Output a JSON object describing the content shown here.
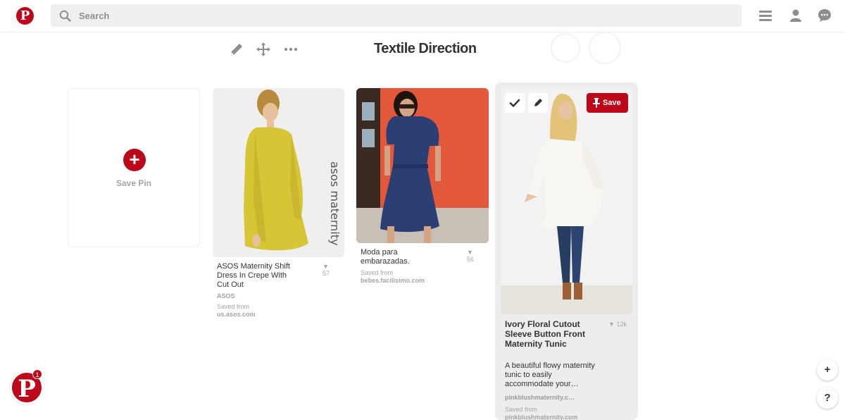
{
  "header": {
    "logo_glyph": "P",
    "search_placeholder": "Search",
    "icons": [
      "menu-icon",
      "profile-icon",
      "messages-icon"
    ]
  },
  "board": {
    "title": "Textile Direction",
    "tools": [
      "edit-pencil-icon",
      "move-arrows-icon",
      "more-dots-icon"
    ]
  },
  "save_pin": {
    "label": "Save Pin",
    "icon": "plus-icon"
  },
  "pins": [
    {
      "description": "ASOS Maternity Shift Dress In Crepe With Cut Out",
      "repins": "57",
      "source_name": "ASOS",
      "saved_from_label": "Saved from",
      "saved_from_domain": "us.asos.com",
      "image_watermark": "asos maternity"
    },
    {
      "description": "Moda para embarazadas.",
      "repins": "56",
      "saved_from_label": "Saved from",
      "saved_from_domain": "bebes.facilisimo.com"
    },
    {
      "title": "Ivory Floral Cutout Sleeve Button Front Maternity Tunic",
      "repins": "12k",
      "description": "A beautiful flowy maternity tunic to easily accommodate your…",
      "source_name": "pinkblushmaternity.c…",
      "saved_from_label": "Saved from",
      "saved_from_domain": "pinkblushmaternity.com",
      "save_button": "Save"
    }
  ],
  "floating": {
    "notification_count": "1",
    "add_button": "+",
    "help_button": "?"
  },
  "colors": {
    "brand": "#bd081c"
  }
}
